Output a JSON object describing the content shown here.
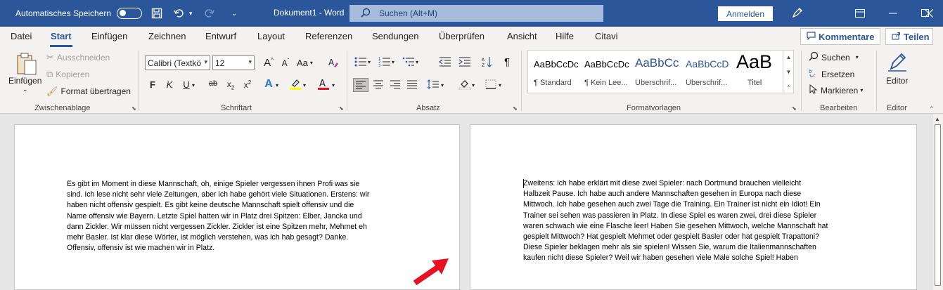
{
  "titlebar": {
    "autosave_label": "Automatisches Speichern",
    "doc_title": "Dokument1  -  Word",
    "search_placeholder": "Suchen (Alt+M)",
    "signin_label": "Anmelden"
  },
  "tabs": [
    "Datei",
    "Start",
    "Einfügen",
    "Zeichnen",
    "Entwurf",
    "Layout",
    "Referenzen",
    "Sendungen",
    "Überprüfen",
    "Ansicht",
    "Hilfe",
    "Citavi"
  ],
  "active_tab": "Start",
  "tab_buttons": {
    "comments": "Kommentare",
    "share": "Teilen"
  },
  "clipboard": {
    "paste": "Einfügen",
    "cut": "Ausschneiden",
    "copy": "Kopieren",
    "format_painter": "Format übertragen",
    "group_label": "Zwischenablage"
  },
  "font": {
    "name": "Calibri (Textkö",
    "size": "12",
    "bold": "F",
    "italic": "K",
    "underline": "U",
    "strike": "ab",
    "subscript": "x",
    "subscript_mark": "2",
    "superscript": "x",
    "superscript_mark": "2",
    "change_case": "Aa",
    "group_label": "Schriftart"
  },
  "paragraph": {
    "group_label": "Absatz",
    "pilcrow": "¶"
  },
  "styles": {
    "group_label": "Formatvorlagen",
    "items": [
      {
        "sample": "AaBbCcDc",
        "name": "¶ Standard"
      },
      {
        "sample": "AaBbCcDc",
        "name": "¶ Kein Lee..."
      },
      {
        "sample": "AaBbCc",
        "name": "Überschrif..."
      },
      {
        "sample": "AaBbCcD",
        "name": "Überschrif..."
      },
      {
        "sample": "AaB",
        "name": "Titel"
      }
    ]
  },
  "editing": {
    "find": "Suchen",
    "replace": "Ersetzen",
    "select": "Markieren",
    "group_label": "Bearbeiten"
  },
  "editor": {
    "button": "Editor",
    "group_label": "Editor"
  },
  "pages": {
    "left_lines": [
      "Es gibt im Moment in diese Mannschaft, oh, einige Spieler vergessen ihnen Profi was sie",
      "sind. Ich lese nicht sehr viele Zeitungen, aber ich habe gehört viele Situationen. Erstens: wir",
      "haben nicht offensiv gespielt. Es gibt keine deutsche Mannschaft spielt offensiv und die",
      "Name offensiv wie Bayern. Letzte Spiel hatten wir in Platz drei Spitzen: Elber, Jancka und",
      "dann Zickler. Wir müssen nicht vergessen Zickler. Zickler ist eine Spitzen mehr, Mehmet eh",
      "mehr Basler. Ist klar diese Wörter, ist möglich verstehen, was ich hab gesagt? Danke.",
      "Offensiv, offensiv ist wie machen wir in Platz."
    ],
    "right_lines": [
      "Zweitens: ich habe erklärt mit diese zwei Spieler: nach Dortmund brauchen vielleicht",
      "Halbzeit Pause. Ich habe auch andere Mannschaften gesehen in Europa nach diese",
      "Mittwoch. Ich habe gesehen auch zwei Tage die Training. Ein Trainer ist nicht ein Idiot! Ein",
      "Trainer sei sehen was passieren in Platz. In diese Spiel es waren zwei, drei diese Spieler",
      "waren schwach wie eine Flasche leer! Haben Sie gesehen Mittwoch, welche Mannschaft hat",
      "gespielt Mittwoch? Hat gespielt Mehmet oder gespielt Basler oder hat gespielt Trapattoni?",
      "Diese Spieler beklagen mehr als sie spielen! Wissen Sie, warum die Italienmannschaften",
      "kaufen nicht diese Spieler? Weil wir haben gesehen viele Male solche Spiel! Haben"
    ]
  },
  "colors": {
    "brand": "#2b579a",
    "highlight": "#ffff00",
    "font_color": "#e81123",
    "annotation_arrow": "#e81123"
  }
}
